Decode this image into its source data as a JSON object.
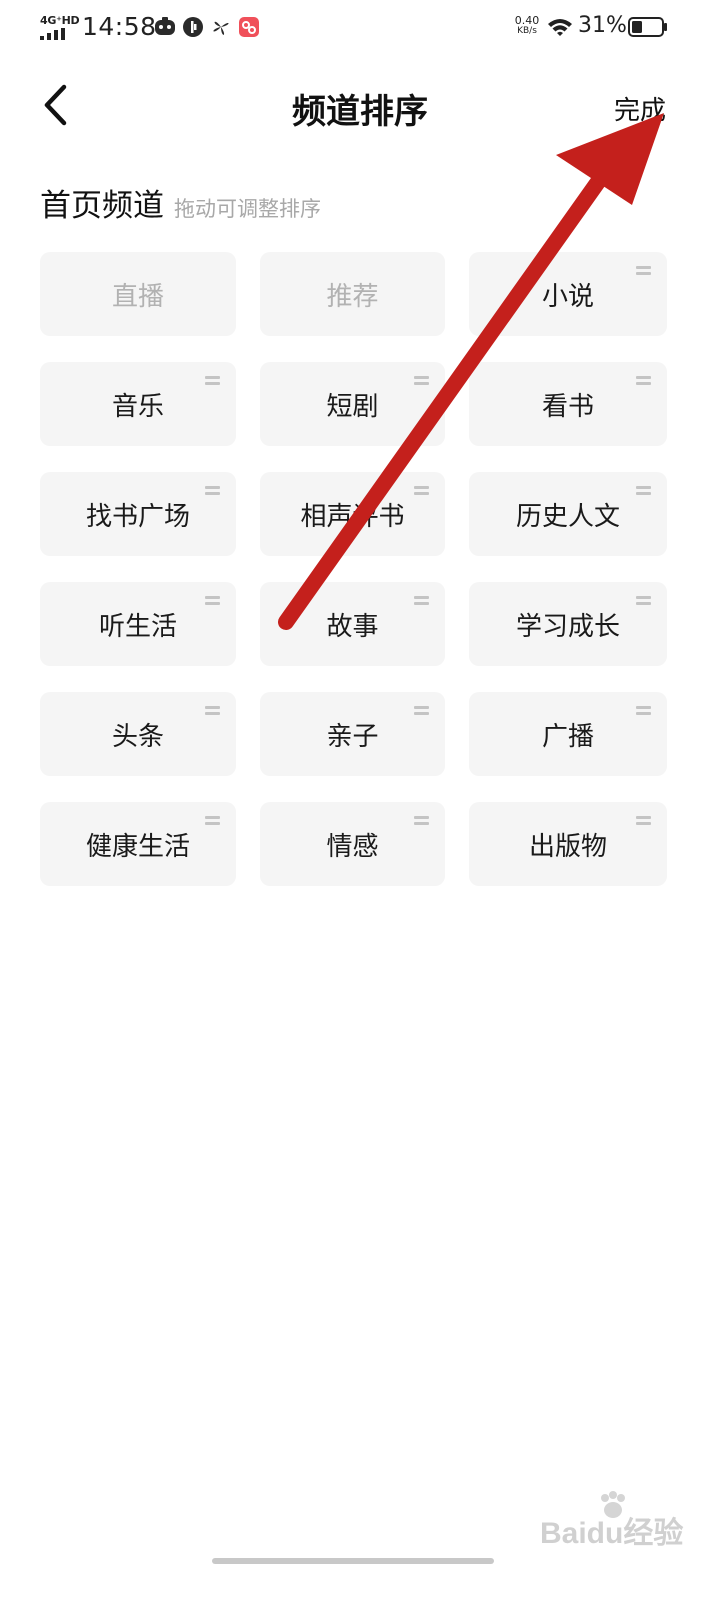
{
  "status_bar": {
    "network": "4G⁺HD",
    "time": "14:58",
    "speed_value": "0.40",
    "speed_unit": "KB/s",
    "battery_percent": "31%",
    "app_icons": [
      "game-controller-icon",
      "timer-app-icon",
      "pinwheel-app-icon",
      "red-app-icon"
    ]
  },
  "header": {
    "title": "频道排序",
    "done_label": "完成",
    "back_icon": "chevron-left-icon"
  },
  "section": {
    "title": "首页频道",
    "hint": "拖动可调整排序"
  },
  "channels": [
    {
      "label": "直播",
      "fixed": true
    },
    {
      "label": "推荐",
      "fixed": true
    },
    {
      "label": "小说",
      "fixed": false
    },
    {
      "label": "音乐",
      "fixed": false
    },
    {
      "label": "短剧",
      "fixed": false
    },
    {
      "label": "看书",
      "fixed": false
    },
    {
      "label": "找书广场",
      "fixed": false
    },
    {
      "label": "相声评书",
      "fixed": false
    },
    {
      "label": "历史人文",
      "fixed": false
    },
    {
      "label": "听生活",
      "fixed": false
    },
    {
      "label": "故事",
      "fixed": false
    },
    {
      "label": "学习成长",
      "fixed": false
    },
    {
      "label": "头条",
      "fixed": false
    },
    {
      "label": "亲子",
      "fixed": false
    },
    {
      "label": "广播",
      "fixed": false
    },
    {
      "label": "健康生活",
      "fixed": false
    },
    {
      "label": "情感",
      "fixed": false
    },
    {
      "label": "出版物",
      "fixed": false
    }
  ],
  "watermark": {
    "text": "Baidu经验"
  },
  "colors": {
    "tile_bg": "#f5f5f5",
    "fixed_text": "#b2b2b2",
    "annotation_arrow": "#c4201c"
  }
}
